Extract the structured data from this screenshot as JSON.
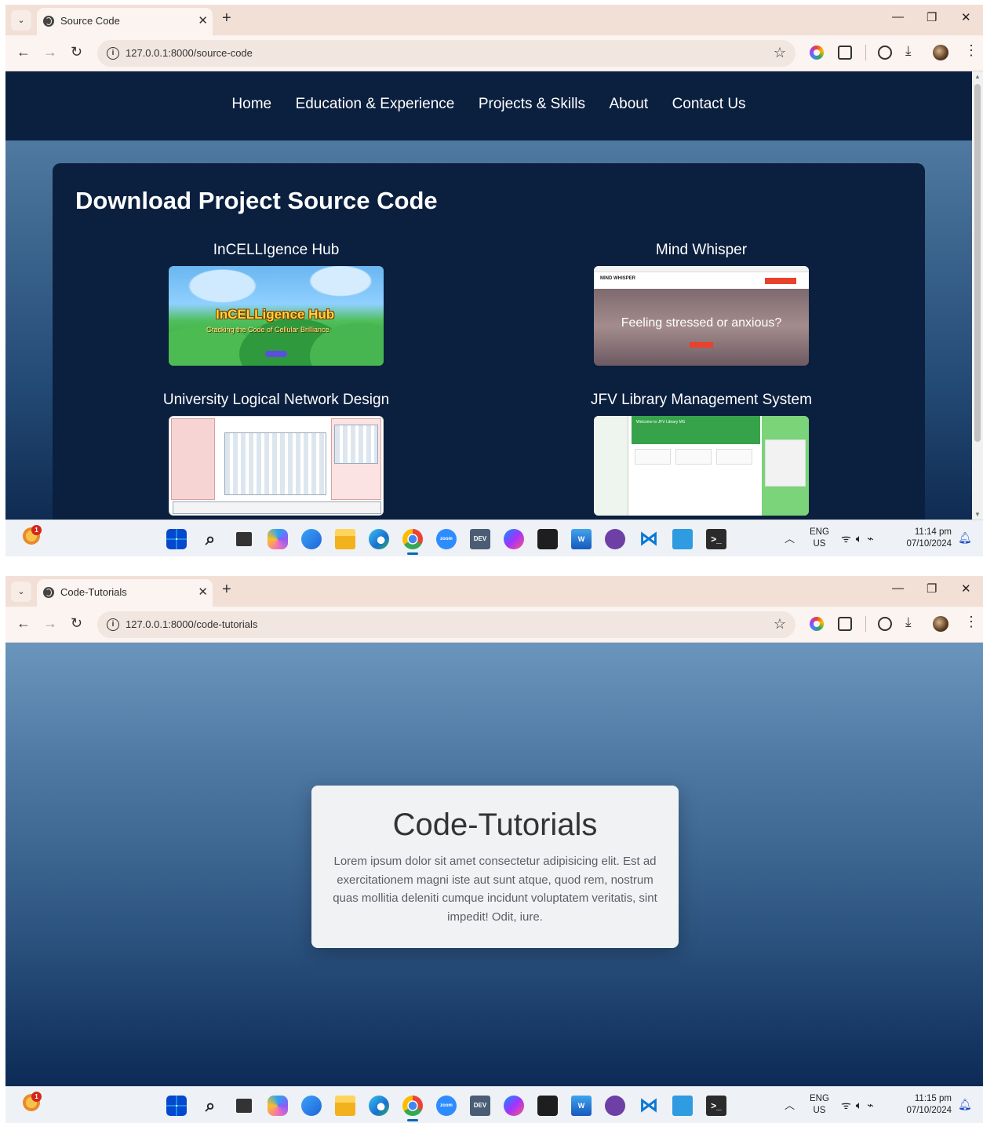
{
  "screens": [
    {
      "tab": {
        "title": "Source Code"
      },
      "address": {
        "url": "127.0.0.1:8000/source-code"
      },
      "nav": [
        "Home",
        "Education & Experience",
        "Projects & Skills",
        "About",
        "Contact Us"
      ],
      "panel": {
        "title": "Download Project Source Code",
        "projects": [
          {
            "name": "InCELLIgence Hub",
            "thumb_logo": "InCELLigence Hub",
            "thumb_tagline": "Cracking the Code of Cellular Brilliance"
          },
          {
            "name": "Mind Whisper",
            "thumb_brand": "MIND WHISPER",
            "thumb_headline": "Feeling stressed or anxious?"
          },
          {
            "name": "University Logical Network Design"
          },
          {
            "name": "JFV Library Management System",
            "thumb_heading": "Welcome to JFV Library MS"
          }
        ]
      },
      "taskbar": {
        "weather_badge": "1",
        "lang": "ENG",
        "region": "US",
        "time": "11:14 pm",
        "date": "07/10/2024"
      }
    },
    {
      "tab": {
        "title": "Code-Tutorials"
      },
      "address": {
        "url": "127.0.0.1:8000/code-tutorials"
      },
      "card": {
        "title": "Code-Tutorials",
        "text": "Lorem ipsum dolor sit amet consectetur adipisicing elit. Est ad exercitationem magni iste aut sunt atque, quod rem, nostrum quas mollitia deleniti cumque incidunt voluptatem veritatis, sint impedit! Odit, iure."
      },
      "taskbar": {
        "weather_badge": "1",
        "lang": "ENG",
        "region": "US",
        "time": "11:15 pm",
        "date": "07/10/2024"
      }
    }
  ],
  "icons": {
    "browser": [
      "tab-search-icon",
      "globe-icon",
      "close-icon",
      "new-tab-icon",
      "minimize-icon",
      "restore-icon",
      "window-close-icon",
      "back-icon",
      "forward-icon",
      "reload-icon",
      "info-icon",
      "star-icon",
      "color-extension-icon",
      "puzzle-extension-icon",
      "circle-extension-icon",
      "download-icon",
      "avatar-icon",
      "menu-icon"
    ],
    "taskbar": [
      "weather-icon",
      "windows-start-icon",
      "search-icon",
      "task-view-icon",
      "copilot-icon",
      "store-icon",
      "file-explorer-icon",
      "edge-icon",
      "chrome-icon",
      "zoom-icon",
      "dev-icon",
      "messenger-icon",
      "figma-icon",
      "word-icon",
      "github-icon",
      "vscode-icon",
      "notepad-icon",
      "terminal-icon",
      "chevron-up-icon",
      "wifi-icon",
      "volume-icon",
      "battery-icon",
      "bell-icon"
    ]
  },
  "colors": {
    "nav_bg": "#0b1f3e",
    "tab_strip": "#f2dfd6",
    "card_bg": "#f1f2f4"
  }
}
